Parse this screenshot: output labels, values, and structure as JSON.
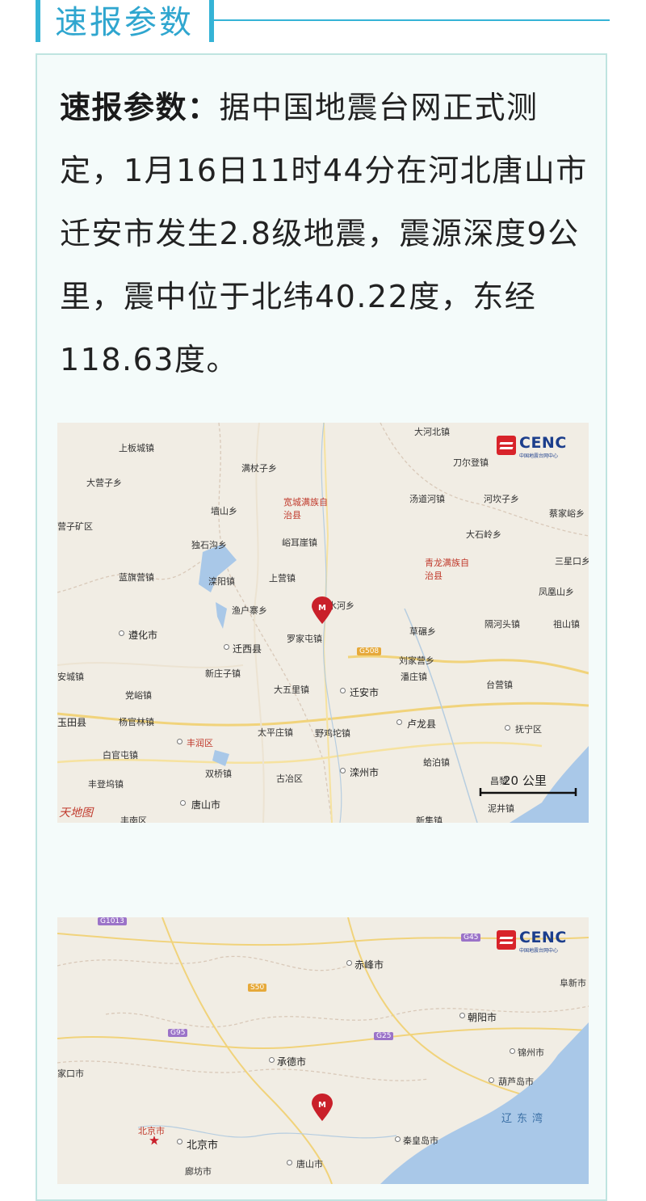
{
  "header": {
    "title": "速报参数"
  },
  "report": {
    "label": "速报参数：",
    "body": "据中国地震台网正式测定，1月16日11时44分在河北唐山市迁安市发生2.8级地震，震源深度9公里，震中位于北纬40.22度，东经118.63度。"
  },
  "brand": {
    "name": "CENC",
    "subtitle": "中国地震台网中心"
  },
  "map1": {
    "scale_label": "20 公里",
    "watermark": "天地图",
    "labels": [
      "上板城镇",
      "满杖子乡",
      "大河北镇",
      "刀尔登镇",
      "大营子乡",
      "宽城满族自治县",
      "汤道河镇",
      "河坎子乡",
      "营子矿区",
      "墙山乡",
      "峪耳崖镇",
      "大石岭乡",
      "蔡家峪乡",
      "独石沟乡",
      "青龙满族自治县",
      "三星口乡",
      "蓝旗营镇",
      "滦阳镇",
      "上营镇",
      "凤凰山乡",
      "渔户寨乡",
      "水河乡",
      "隔河头镇",
      "祖山镇",
      "遵化市",
      "罗家屯镇",
      "草碾乡",
      "迁西县",
      "刘家营乡",
      "新庄子镇",
      "潘庄镇",
      "安城镇",
      "大五里镇",
      "迁安市",
      "台营镇",
      "党峪镇",
      "卢龙县",
      "玉田县",
      "杨官林镇",
      "太平庄镇",
      "野鸡坨镇",
      "抚宁区",
      "丰润区",
      "白官屯镇",
      "蛤泊镇",
      "双桥镇",
      "古冶区",
      "滦州市",
      "昌黎",
      "丰登坞镇",
      "唐山市",
      "泥井镇",
      "丰南区",
      "新集镇",
      "G508"
    ]
  },
  "map2": {
    "labels": [
      "G1013",
      "G45",
      "赤峰市",
      "阜新市",
      "S50",
      "朝阳市",
      "G95",
      "G25",
      "承德市",
      "锦州市",
      "家口市",
      "葫芦岛市",
      "北京市",
      "北京市",
      "秦皇岛市",
      "廊坊市",
      "唐山市",
      "辽东湾"
    ]
  }
}
